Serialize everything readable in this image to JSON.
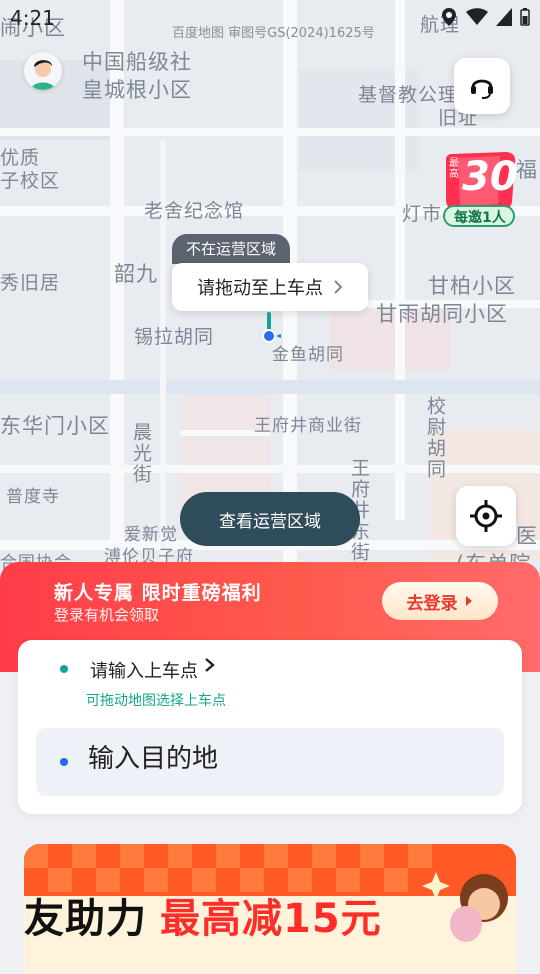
{
  "status_bar": {
    "time": "4:21"
  },
  "map": {
    "copyright": "百度地图 审图号GS(2024)1625号",
    "labels": {
      "l1": "中国船级社",
      "l2": "皇城根小区",
      "l3": "基督教公理",
      "l4": "旧址",
      "l5": "优质",
      "l6": "子校区",
      "l7": "老舍纪念馆",
      "l8": "灯市",
      "l9": "韶九",
      "l10": "秀旧居",
      "l11": "甘柏小区",
      "l12": "甘雨胡同小区",
      "l13": "锡拉胡同",
      "l14": "金鱼胡同",
      "l15": "东华门小区",
      "l16": "王府井商业街",
      "l17": "晨光街",
      "l18": "校尉胡同",
      "l19": "普度寺",
      "l20": "王府井东街",
      "l21": "爱新觉",
      "l22": "溥伦贝子府",
      "l23": "合国协会",
      "l24": "医",
      "l25": "(东单院",
      "l26": "闹小区",
      "l27": "福",
      "l28": "航",
      "l29": "理"
    },
    "not_in_service_tag": "不在运营区域",
    "drag_tip": "请拖动至上车点",
    "view_area_button": "查看运营区域"
  },
  "promo_badge": {
    "top": "最高",
    "amount": "30",
    "sub": "每邀1人"
  },
  "banner": {
    "title": "新人专属 限时重磅福利",
    "subtitle": "登录有机会领取",
    "login_button": "去登录"
  },
  "booking": {
    "pickup_label": "请输入上车点",
    "pickup_hint": "可拖动地图选择上车点",
    "destination_placeholder": "输入目的地"
  },
  "ad": {
    "text1": "友助力",
    "text2": "最高减15元"
  },
  "colors": {
    "accent_teal": "#17a38f",
    "banner_red": "#ff3d4a",
    "dest_blue": "#2468f2"
  }
}
